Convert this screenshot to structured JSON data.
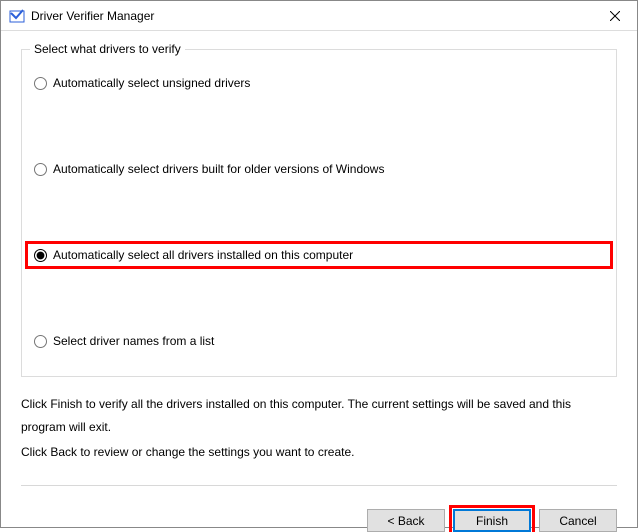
{
  "window": {
    "title": "Driver Verifier Manager"
  },
  "groupbox": {
    "legend": "Select what drivers to verify"
  },
  "options": {
    "0": {
      "label": "Automatically select unsigned drivers"
    },
    "1": {
      "label": "Automatically select drivers built for older versions of Windows"
    },
    "2": {
      "label": "Automatically select all drivers installed on this computer"
    },
    "3": {
      "label": "Select driver names from a list"
    }
  },
  "instructions": {
    "line1": "Click Finish to verify all the drivers installed on this computer. The current settings will be saved and this program will exit.",
    "line2": "Click Back to review or change the settings you want to create."
  },
  "buttons": {
    "back": "< Back",
    "finish": "Finish",
    "cancel": "Cancel"
  }
}
